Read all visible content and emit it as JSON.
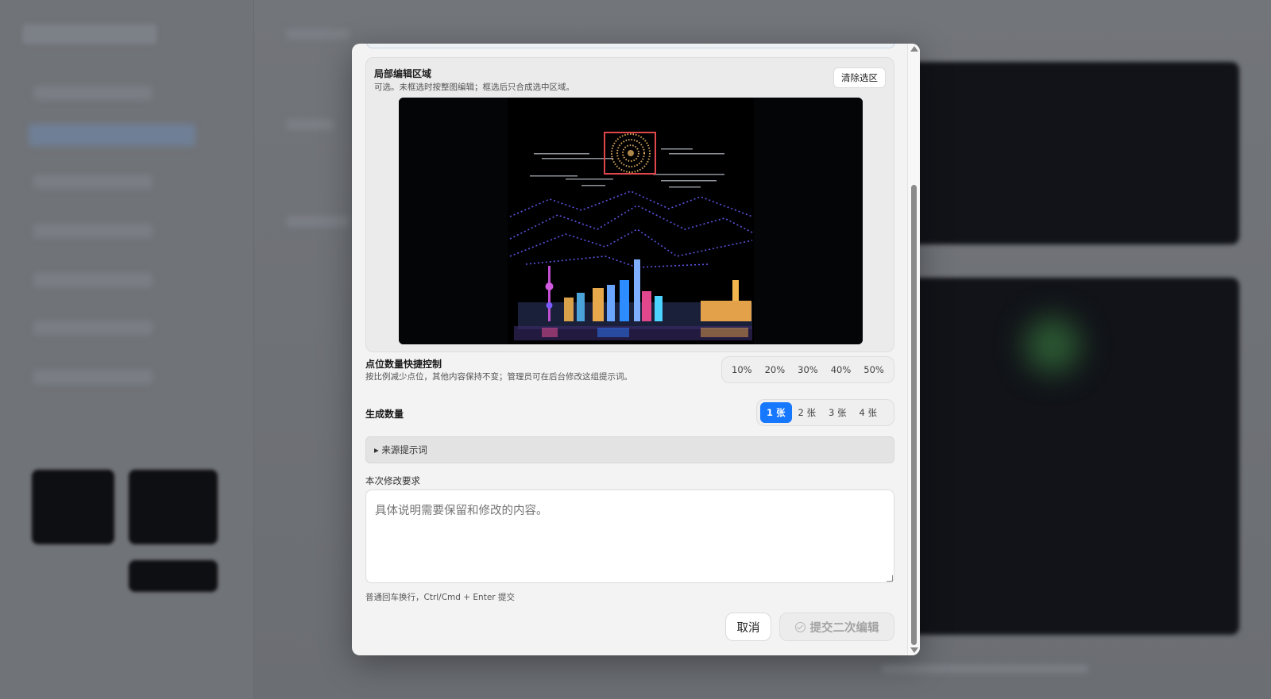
{
  "local_edit": {
    "title": "局部编辑区域",
    "description": "可选。未框选时按整图编辑；框选后只合成选中区域。",
    "clear_button": "清除选区"
  },
  "point_control": {
    "title": "点位数量快捷控制",
    "description": "按比例减少点位，其他内容保持不变；管理员可在后台修改这组提示词。",
    "options": [
      "10%",
      "20%",
      "30%",
      "40%",
      "50%"
    ]
  },
  "count": {
    "title": "生成数量",
    "options": [
      "1 张",
      "2 张",
      "3 张",
      "4 张"
    ],
    "selected": "1 张"
  },
  "source_prompt": {
    "label": "▸ 来源提示词"
  },
  "edit_request": {
    "label": "本次修改要求",
    "placeholder": "具体说明需要保留和修改的内容。",
    "hint": "普通回车换行，Ctrl/Cmd + Enter 提交"
  },
  "actions": {
    "cancel": "取消",
    "submit": "提交二次编辑"
  },
  "colors": {
    "accent": "#1677ff",
    "selection": "#e0474c"
  }
}
